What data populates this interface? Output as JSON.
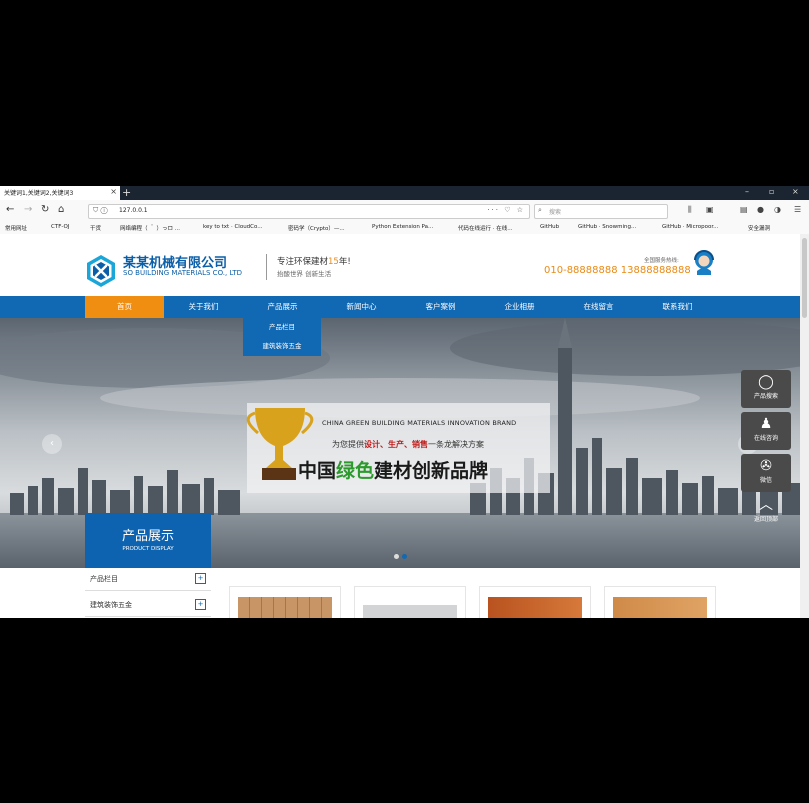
{
  "browser": {
    "tab_title": "关键词1,关键词2,关键词3",
    "tab_close": "×",
    "new_tab": "+",
    "window_controls": [
      "–",
      "▫",
      "×"
    ],
    "url": "127.0.0.1",
    "search_placeholder": "搜索",
    "bookmarks": [
      "常用网址",
      "CTF-OJ",
      "干货",
      "网络编程（ ＾ ）っロ ...",
      "key to txt · CloudCo...",
      "密码学（Crypto）—...",
      "Python Extension Pa...",
      "代码在线运行 · 在线...",
      "GitHub",
      "GitHub · Snowming...",
      "GitHub · Micropoor...",
      "安全漏洞"
    ]
  },
  "header": {
    "brand_cn": "某某机械有限公司",
    "brand_en": "SO BUILDING MATERIALS CO., LTD",
    "slogan_prefix": "专注环保建材",
    "slogan_years": "15",
    "slogan_suffix": "年!",
    "slogan_sub": "抬酸世界 创新生活",
    "hotline_label": "全国服务热线:",
    "hotline": "010-88888888 13888888888"
  },
  "nav": {
    "items": [
      "首页",
      "关于我们",
      "产品展示",
      "新闻中心",
      "客户案例",
      "企业相册",
      "在线留言",
      "联系我们"
    ],
    "active_index": 0,
    "dropdown": [
      "产品栏目",
      "建筑装饰五金"
    ]
  },
  "banner": {
    "en_line": "CHINA GREEN BUILDING MATERIALS INNOVATION BRAND",
    "sub_prefix": "为您提供",
    "sub_highlight": "设计、生产、销售",
    "sub_suffix": "一条龙解决方案",
    "main_prefix": "中国",
    "main_green": "绿色",
    "main_suffix": "建材创新品牌",
    "prev": "‹",
    "next": "›",
    "slide_count": 2,
    "active_slide": 1
  },
  "side_panel": [
    {
      "icon": "search-icon",
      "label": "产品搜索",
      "glyph": "◯"
    },
    {
      "icon": "chat-icon",
      "label": "在线咨询",
      "glyph": "♟"
    },
    {
      "icon": "wechat-icon",
      "label": "微信",
      "glyph": "✇"
    },
    {
      "icon": "up-arrow-icon",
      "label": "返回顶部",
      "glyph": "︿"
    }
  ],
  "products": {
    "title_cn": "产品展示",
    "title_en": "PRODUCT DISPLAY",
    "categories": [
      "产品栏目",
      "建筑装饰五金"
    ],
    "expand_glyph": "+"
  },
  "colors": {
    "primary": "#1168b3",
    "accent": "#f08e12",
    "green": "#2c9a2c",
    "red": "#c01a1a"
  }
}
